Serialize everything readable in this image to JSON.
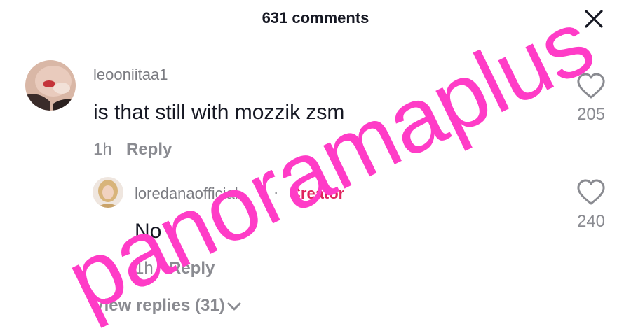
{
  "header": {
    "title": "631 comments",
    "close_icon": "close-icon"
  },
  "comment": {
    "username": "leooniitaa1",
    "text": "is that still with mozzik zsm",
    "time": "1h",
    "reply_label": "Reply",
    "likes": "205",
    "like_icon": "heart-outline-icon"
  },
  "reply": {
    "username": "loredanaofficial",
    "separator": "·",
    "badge": "Creator",
    "text": "No",
    "time": "1h",
    "reply_label": "Reply",
    "likes": "240",
    "like_icon": "heart-outline-icon"
  },
  "view_replies": {
    "label": "View replies (31)",
    "icon": "chevron-down-icon"
  },
  "watermark": {
    "text": "panoramaplus"
  },
  "colors": {
    "creator_badge": "#e0245e",
    "watermark": "#ff3cc7",
    "secondary_text": "#8a8b91"
  }
}
